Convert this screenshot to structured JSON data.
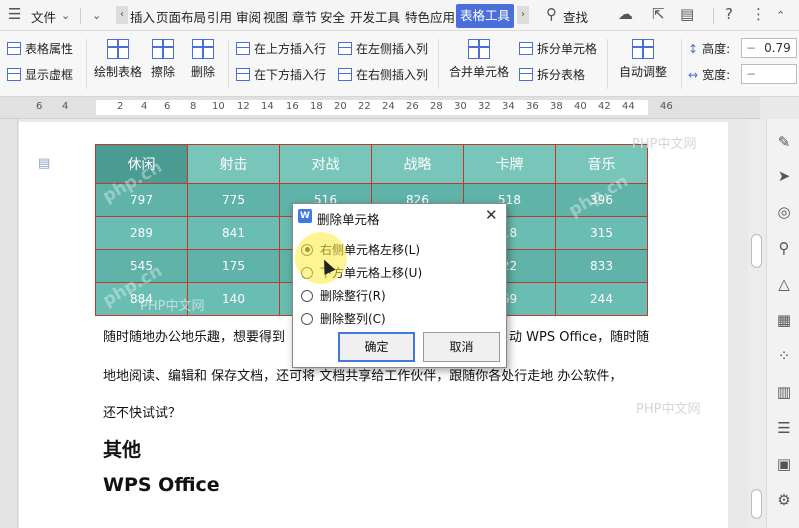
{
  "menubar": {
    "items": [
      "文件",
      "插入",
      "页面布局",
      "引用",
      "审阅",
      "视图",
      "章节",
      "安全",
      "开发工具",
      "特色应用"
    ],
    "active_tab": "表格工具",
    "search": "查找"
  },
  "ribbon": {
    "table_props": "表格属性",
    "show_grid": "显示虚框",
    "draw_table": "绘制表格",
    "erase": "擦除",
    "delete": "删除",
    "insert_above": "在上方插入行",
    "insert_below": "在下方插入行",
    "insert_left": "在左侧插入列",
    "insert_right": "在右侧插入列",
    "merge_cells": "合并单元格",
    "split_cells": "拆分单元格",
    "split_table": "拆分表格",
    "auto_fit": "自动调整",
    "height_label": "高度:",
    "height_value": "0.79",
    "width_label": "宽度:",
    "width_value": ""
  },
  "ruler": {
    "numbers": [
      "6",
      "4",
      "2",
      "2",
      "4",
      "6",
      "8",
      "10",
      "12",
      "14",
      "16",
      "18",
      "20",
      "22",
      "24",
      "26",
      "28",
      "30",
      "32",
      "34",
      "36",
      "38",
      "40",
      "42",
      "44",
      "46"
    ]
  },
  "table": {
    "headers": [
      "休闲",
      "射击",
      "对战",
      "战略",
      "卡牌",
      "音乐"
    ],
    "rows": [
      [
        "797",
        "775",
        "516",
        "826",
        "518",
        "396"
      ],
      [
        "289",
        "841",
        "",
        "",
        "18",
        "315"
      ],
      [
        "545",
        "175",
        "",
        "",
        "22",
        "833"
      ],
      [
        "884",
        "140",
        "",
        "",
        "69",
        "244"
      ]
    ]
  },
  "document": {
    "line1_a": "随时随地办公地乐趣，想要得到",
    "line1_b": "动 WPS Office，随时随",
    "line2": "地地阅读、编辑和  保存文档，还可将  文档共享给工作伙伴，跟随你各处行走地  办公软件，",
    "line3": "还不快试试？",
    "heading1": "其他",
    "heading2": "WPS Office"
  },
  "watermark": {
    "text": "PHP中文网",
    "diag": "php.cn"
  },
  "dialog": {
    "title": "删除单元格",
    "options": [
      "右侧单元格左移(L)",
      "下方单元格上移(U)",
      "删除整行(R)",
      "删除整列(C)"
    ],
    "ok": "确定",
    "cancel": "取消"
  }
}
